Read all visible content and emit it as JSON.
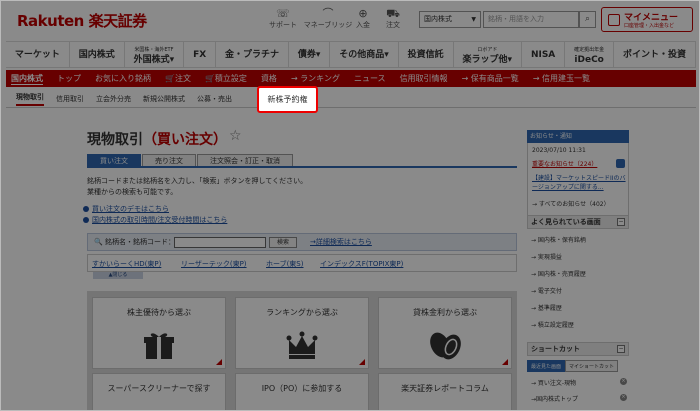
{
  "header": {
    "logo": "Rakuten 楽天証券",
    "icons": [
      {
        "label": "サポート",
        "icon": "headset-icon",
        "glyph": "☏"
      },
      {
        "label": "マネーブリッジ",
        "icon": "bridge-icon",
        "glyph": "⌒"
      },
      {
        "label": "入金",
        "icon": "deposit-icon",
        "glyph": "⊕"
      },
      {
        "label": "注文",
        "icon": "cart-icon",
        "glyph": "⛟"
      }
    ],
    "market_select": "国内株式",
    "search_placeholder": "銘柄・用語を入力",
    "search_icon_glyph": "⌕",
    "mymenu": {
      "title": "マイメニュー",
      "sub": "口座管理・入出金など"
    }
  },
  "nav_main": [
    {
      "label": "マーケット"
    },
    {
      "label": "国内株式"
    },
    {
      "label": "外国株式▾",
      "sub": "米国株・海外ETF"
    },
    {
      "label": "FX"
    },
    {
      "label": "金・プラチナ"
    },
    {
      "label": "債券▾"
    },
    {
      "label": "その他商品▾"
    },
    {
      "label": "投資信託"
    },
    {
      "label": "楽ラップ他▾",
      "sub": "ロボアド"
    },
    {
      "label": "NISA"
    },
    {
      "label": "iDeCo",
      "sub": "確定拠出年金"
    },
    {
      "label": "ポイント・投資",
      "sub": ""
    }
  ],
  "nav_sub": [
    "国内株式",
    "トップ",
    "お気に入り銘柄",
    "🛒注文",
    "🛒積立設定",
    "資格",
    "→ ランキング",
    "ニュース",
    "信用取引情報",
    "→ 保有商品一覧",
    "→ 信用建玉一覧"
  ],
  "nav_tabs": [
    "現物取引",
    "信用取引",
    "立会外分売",
    "新規公開株式",
    "公募・売出"
  ],
  "highlight_tab": "新株予約権",
  "page": {
    "title": "現物取引",
    "title_paren": "（買い注文）",
    "star": "☆",
    "tabs": [
      "買い注文",
      "売り注文",
      "注文照会・訂正・取消"
    ],
    "desc1": "銘柄コードまたは銘柄名を入力し、「検索」ボタンを押してください。",
    "desc2": "業種からの検索も可能です。",
    "link1": "買い注文のデモはこちら",
    "link2": "国内株式の取引時間/注文受付時間はこちら",
    "search_label": "🔍 銘柄名・銘柄コード：",
    "search_btn": "検索",
    "detail_link": "→詳細検索はこちら",
    "history": [
      "すかいらーくHD(東P)",
      "リーザーテック(東P)",
      "ホーブ(東S)",
      "インデックスF(TOPIX東P)"
    ],
    "close_btn": "▲閉じる",
    "cards": [
      {
        "label": "株主優待から選ぶ",
        "icon": "gift-icon"
      },
      {
        "label": "ランキングから選ぶ",
        "icon": "crown-icon"
      },
      {
        "label": "貸株金利から選ぶ",
        "icon": "coins-icon"
      },
      {
        "label": "スーパースクリーナーで探す",
        "icon": "screener-icon"
      },
      {
        "label": "IPO（PO）に参加する",
        "icon": "ipo-icon"
      },
      {
        "label": "楽天証券レポートコラム",
        "icon": "report-icon"
      }
    ]
  },
  "sidebar": {
    "notice_header": "お知らせ・通知",
    "date": "2023/07/10 11:31",
    "important": "重要なお知らせ（224）",
    "notice_link": "【建設】マーケットスピードIIのバージョンアップに関する...",
    "all_notices": "→ すべてのお知らせ（402）",
    "frequent_title": "よく見られている画面",
    "frequent": [
      "→ 国内株・保有銘柄",
      "→ 実現損益",
      "→ 国内株・売買履歴",
      "→ 電子交付",
      "→ 基準履歴",
      "→ 積立設定履歴"
    ],
    "shortcut_title": "ショートカット",
    "shortcut_tabs": [
      "最近見た画面",
      "マイショートカット"
    ],
    "shortcut_items": [
      "→ 買い注文-現物",
      "→国内株式トップ"
    ]
  }
}
